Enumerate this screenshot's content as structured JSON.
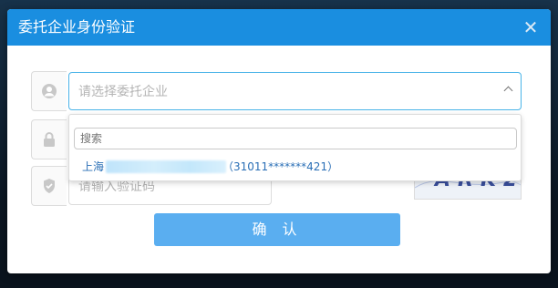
{
  "dialog": {
    "title": "委托企业身份验证",
    "close_icon": "close-icon"
  },
  "enterprise_select": {
    "placeholder": "请选择委托企业",
    "icon": "user-icon"
  },
  "dropdown": {
    "search_placeholder": "搜索",
    "options": [
      {
        "prefix": "上海",
        "code": "（31011*******421）"
      }
    ]
  },
  "password_row": {
    "icon": "lock-icon"
  },
  "captcha_row": {
    "icon": "shield-icon",
    "placeholder": "请输入验证码",
    "captcha_text": "ARK2"
  },
  "confirm_button": "确 认",
  "colors": {
    "header": "#1a8ee0",
    "button": "#5aaef0",
    "link": "#2a6fb6"
  }
}
